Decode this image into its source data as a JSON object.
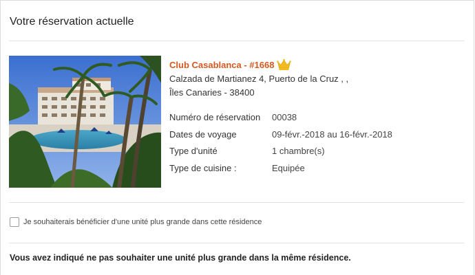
{
  "page": {
    "title": "Votre réservation actuelle"
  },
  "reservation": {
    "name": "Club Casablanca - #1668",
    "address_line1": "Calzada de Martianez 4, Puerto de la Cruz ,  ,",
    "address_line2": "Îles Canaries  -  38400",
    "crown_icon": "crown-icon",
    "accent_color": "#d4581f",
    "crown_color": "#f2bd1c",
    "details": [
      {
        "label": "Numéro de réservation",
        "value": "00038"
      },
      {
        "label": "Dates de voyage",
        "value": "09-févr.-2018 au 16-févr.-2018"
      },
      {
        "label": "Type d'unité",
        "value": "1  chambre(s)"
      },
      {
        "label": "Type de cuisine :",
        "value": "Equipée"
      }
    ]
  },
  "upgrade_option": {
    "label": "Je souhaiterais bénéficier d'une unité plus grande dans cette résidence",
    "checked": false
  },
  "notice": "Vous avez indiqué ne pas souhaiter une unité plus grande dans la même résidence."
}
